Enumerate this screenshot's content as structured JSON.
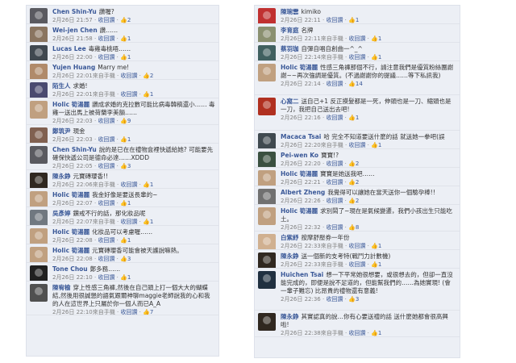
{
  "accent": "#3b5998",
  "meta": {
    "from_mobile": "來自手機",
    "sep": " · ",
    "unlike": "收回讚"
  },
  "left": [
    {
      "author": "Chen Shin-Yu",
      "text": "讚喔?",
      "time": "2月26日 21:57",
      "likes": "2",
      "mobile": false,
      "avatar_color": "#5a5a60",
      "h": 23
    },
    {
      "author": "Wei-jen Chen",
      "text": "讚……",
      "time": "2月26日 21:58",
      "likes": "1",
      "mobile": false,
      "avatar_color": "#8a7560",
      "h": 23
    },
    {
      "author": "Lucas Lee",
      "text": "毒雞毒桃唔……",
      "time": "2月26日 22:00",
      "likes": "1",
      "mobile": false,
      "avatar_color": "#404850",
      "h": 23
    },
    {
      "author": "Yujen Huang",
      "text": "Marry me!",
      "time": "2月26日 22:01",
      "likes": "2",
      "mobile": true,
      "avatar_color": "#b08a6a",
      "h": 23
    },
    {
      "author": "陌生人",
      "text": "求婚!",
      "time": "2月26日 22:01",
      "likes": "1",
      "mobile": true,
      "avatar_color": "#4a4a70",
      "h": 23
    },
    {
      "author": "Holic 筍湯麗",
      "text": "讚成求婚的克拉數可能比病毒韓稿還小…… 毒雞一送出馬上被荷蘭李美韻……",
      "time": "2月26日 22:03",
      "likes": "9",
      "mobile": false,
      "avatar_color": "#c0a080",
      "h": 33
    },
    {
      "author": "鄭筑尹",
      "text": "現金",
      "time": "2月26日 22:03",
      "likes": "1",
      "mobile": false,
      "avatar_color": "#806050",
      "h": 23
    },
    {
      "author": "Chen Shin-Yu",
      "text": "說的是已在在禮物盒裡快遞給她? 可能要先確保快遞公司是德命必達……XDDD",
      "time": "2月26日 22:05",
      "likes": "3",
      "mobile": false,
      "avatar_color": "#5a5a60",
      "h": 33
    },
    {
      "author": "陳永錚",
      "text": "元寶磚瓔香!!",
      "time": "2月26日 22:06",
      "likes": "1",
      "mobile": true,
      "avatar_color": "#302820",
      "h": 23
    },
    {
      "author": "Holic 筍湯麗",
      "text": "我金好像是要送長輩的~",
      "time": "2月26日 22:07",
      "likes": "1",
      "mobile": false,
      "avatar_color": "#c0a080",
      "h": 23
    },
    {
      "author": "吳彥婷",
      "text": "鑽戒不行的話，那化妝品呢",
      "time": "2月26日 22:07",
      "likes": "1",
      "mobile": true,
      "avatar_color": "#707880",
      "h": 23
    },
    {
      "author": "Holic 筍湯麗",
      "text": "化妝品可以考慮喔……",
      "time": "2月26日 22:08",
      "likes": "1",
      "mobile": false,
      "avatar_color": "#c0a080",
      "h": 23
    },
    {
      "author": "Holic 筍湯麗",
      "text": "元寶磚瓔香可能會被天護說嘛熱。",
      "time": "2月26日 22:08",
      "likes": "3",
      "mobile": false,
      "avatar_color": "#c0a080",
      "h": 23
    },
    {
      "author": "Tone Chou",
      "text": "鄭多務……",
      "time": "2月26日 22:10",
      "likes": "1",
      "mobile": false,
      "avatar_color": "#202020",
      "h": 23
    },
    {
      "author": "陳宥榆",
      "text": "穿上性感三角褲,然後在自己頭上打一個大大的蝴蝶結,然後用很誠懇的語氣跟爾神聊maggie老師說我的心和我的人在這世界上只屬於你一個人而已A_A",
      "time": "2月26日 22:10",
      "likes": "7",
      "mobile": true,
      "avatar_color": "#505050",
      "h": 42
    }
  ],
  "right": [
    {
      "author": "陳琬雲",
      "text": "kimiko",
      "time": "2月26日 22:11",
      "likes": "1",
      "mobile": false,
      "avatar_color": "#c03030",
      "h": 23
    },
    {
      "author": "李育庭",
      "text": "名牌",
      "time": "2月26日 22:11",
      "likes": "1",
      "mobile": true,
      "avatar_color": "#8a9070",
      "h": 23
    },
    {
      "author": "蔡羽珈",
      "text": "自彈自唱自創曲一^_^",
      "time": "2月26日 22:14",
      "likes": "1",
      "mobile": true,
      "avatar_color": "#406060",
      "h": 23
    },
    {
      "author": "Holic 筍湯麗",
      "text": "性感三角褲那個不行，請注意我們是優質粉絲團謝謝~~再次強調是優質。(不過謝謝你的提議……等下私訊我)",
      "time": "2月26日 22:14",
      "likes": "14",
      "mobile": false,
      "avatar_color": "#c0a080",
      "h": 42
    },
    {
      "author": "心窩二",
      "text": "送自己+1 反正摸髮都是一死，伸頭也是一刀、縮頭也是一刀，我把自己送出去吧!",
      "time": "2月26日 22:16",
      "likes": "1",
      "mobile": false,
      "avatar_color": "#b03020",
      "h": 44
    },
    {
      "author": "Macaca Tsai",
      "text": "哈 完全不知道要送什麼的話 就送她一拳吧(誤",
      "time": "2月26日 22:20",
      "likes": "1",
      "mobile": true,
      "avatar_color": "#404a50",
      "h": 23
    },
    {
      "author": "Pei-wen Ko",
      "text": "寶寶!?",
      "time": "2月26日 22:20",
      "likes": "2",
      "mobile": false,
      "avatar_color": "#3a5040",
      "h": 23
    },
    {
      "author": "Holic 筍湯麗",
      "text": "寶寶是她送我吧……",
      "time": "2月26日 22:21",
      "likes": "2",
      "mobile": false,
      "avatar_color": "#c0a080",
      "h": 23
    },
    {
      "author": "Albert Zheng",
      "text": "我覺得可以讓她在當天送你一個驗孕棒!!",
      "time": "2月26日 22:26",
      "likes": "2",
      "mobile": false,
      "avatar_color": "#707070",
      "h": 23
    },
    {
      "author": "Holic 筍湯麗",
      "text": "求別鬧了~現在是氣候變遷，我們小孩出生只能吃土。",
      "time": "2月26日 22:32",
      "likes": "8",
      "mobile": false,
      "avatar_color": "#c0a080",
      "h": 33
    },
    {
      "author": "白紫紓",
      "text": "按摩舒壓券一年份",
      "time": "2月26日 22:33",
      "likes": "1",
      "mobile": true,
      "avatar_color": "#d0b090",
      "h": 23
    },
    {
      "author": "陳永錚",
      "text": "送一個新的支考特(戰鬥力計數機)",
      "time": "2月26日 22:33",
      "likes": "1",
      "mobile": true,
      "avatar_color": "#302820",
      "h": 23
    },
    {
      "author": "Huichen Tsai",
      "text": "想一下平常她很想要，或很想去的，但卻一直沒能完成的，即便是說不足道的，但能幫我們的……為她實現! (會一輩子難忘) 比昂貴的禮物還有意義!",
      "time": "2月26日 22:36",
      "likes": "3",
      "mobile": false,
      "avatar_color": "#203040",
      "h": 52
    },
    {
      "author": "陳永錚",
      "text": "其實認真的說…你有心要送禮的話 送什麼她都會很高興啦!",
      "time": "2月26日 22:38",
      "likes": "1",
      "mobile": true,
      "avatar_color": "#302820",
      "h": 33
    }
  ]
}
